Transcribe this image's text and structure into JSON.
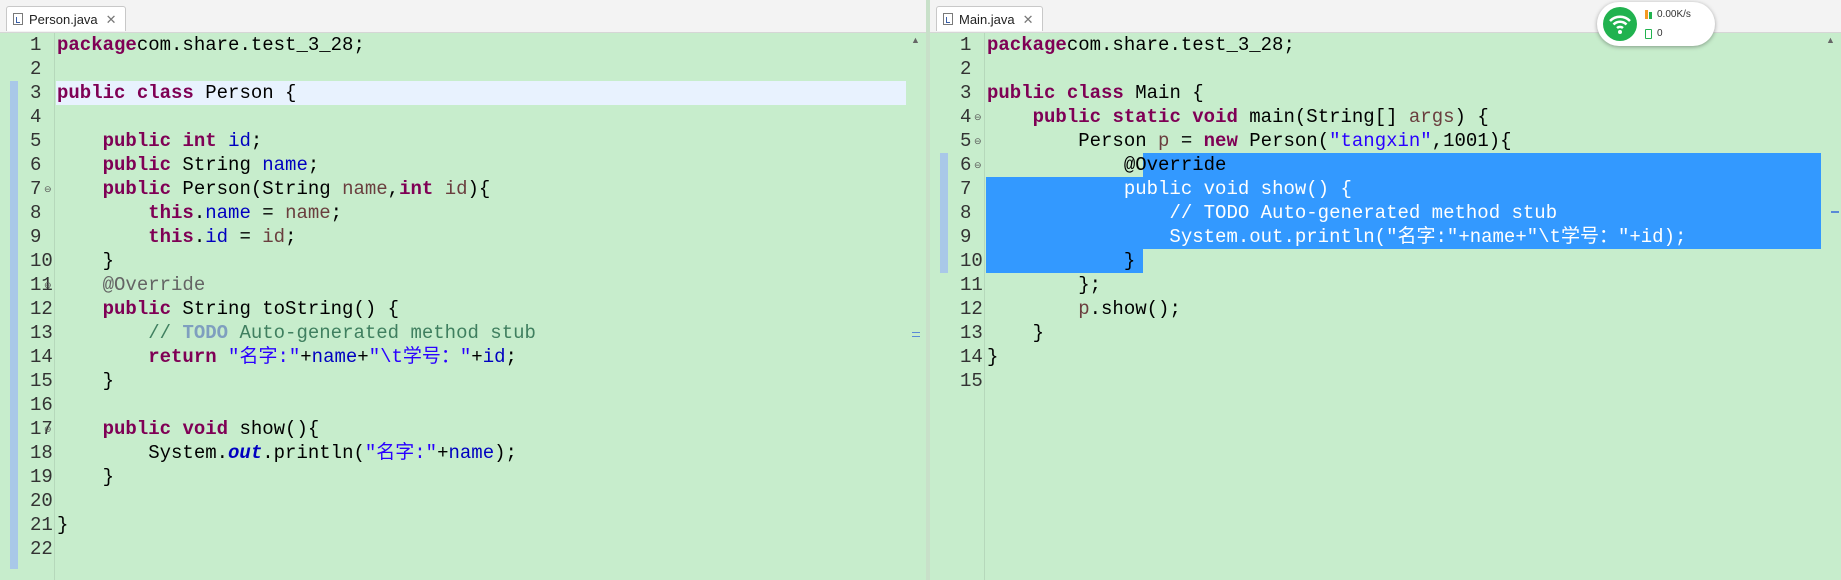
{
  "left_editor": {
    "tab_label": "Person.java",
    "lines": [
      [
        [
          "kw",
          "package"
        ],
        [
          "",
          "com.share.test_3_28;"
        ]
      ],
      [],
      [
        [
          "kw",
          "public"
        ],
        [
          "",
          " "
        ],
        [
          "kw",
          "class"
        ],
        [
          "",
          " Person {"
        ]
      ],
      [],
      [
        [
          "",
          "    "
        ],
        [
          "kw",
          "public"
        ],
        [
          "",
          " "
        ],
        [
          "kw",
          "int"
        ],
        [
          "",
          " "
        ],
        [
          "fld",
          "id"
        ],
        [
          "",
          ";"
        ]
      ],
      [
        [
          "",
          "    "
        ],
        [
          "kw",
          "public"
        ],
        [
          "",
          " String "
        ],
        [
          "fld",
          "name"
        ],
        [
          "",
          ";"
        ]
      ],
      [
        [
          "",
          "    "
        ],
        [
          "kw",
          "public"
        ],
        [
          "",
          " Person(String "
        ],
        [
          "par",
          "name"
        ],
        [
          "",
          ","
        ],
        [
          "kw",
          "int"
        ],
        [
          "",
          " "
        ],
        [
          "par",
          "id"
        ],
        [
          "",
          "){"
        ]
      ],
      [
        [
          "",
          "        "
        ],
        [
          "kw",
          "this"
        ],
        [
          "",
          "."
        ],
        [
          "fld",
          "name"
        ],
        [
          "",
          " = "
        ],
        [
          "par",
          "name"
        ],
        [
          "",
          ";"
        ]
      ],
      [
        [
          "",
          "        "
        ],
        [
          "kw",
          "this"
        ],
        [
          "",
          "."
        ],
        [
          "fld",
          "id"
        ],
        [
          "",
          " = "
        ],
        [
          "par",
          "id"
        ],
        [
          "",
          ";"
        ]
      ],
      [
        [
          "",
          "    }"
        ]
      ],
      [
        [
          "",
          "    "
        ],
        [
          "ann",
          "@Override"
        ]
      ],
      [
        [
          "",
          "    "
        ],
        [
          "kw",
          "public"
        ],
        [
          "",
          " String toString() {"
        ]
      ],
      [
        [
          "",
          "        "
        ],
        [
          "cmt",
          "// "
        ],
        [
          "todo",
          "TODO"
        ],
        [
          "cmt",
          " Auto-generated method stub"
        ]
      ],
      [
        [
          "",
          "        "
        ],
        [
          "kw",
          "return"
        ],
        [
          "",
          " "
        ],
        [
          "str",
          "\"名字:\""
        ],
        [
          "",
          "+"
        ],
        [
          "fld",
          "name"
        ],
        [
          "",
          "+"
        ],
        [
          "str",
          "\"\\t学号：\""
        ],
        [
          "",
          "+"
        ],
        [
          "fld",
          "id"
        ],
        [
          "",
          ";"
        ]
      ],
      [
        [
          "",
          "    }"
        ]
      ],
      [],
      [
        [
          "",
          "    "
        ],
        [
          "kw",
          "public"
        ],
        [
          "",
          " "
        ],
        [
          "kw",
          "void"
        ],
        [
          "",
          " show(){"
        ]
      ],
      [
        [
          "",
          "        System."
        ],
        [
          "stat",
          "out"
        ],
        [
          "",
          ".println("
        ],
        [
          "str",
          "\"名字:\""
        ],
        [
          "",
          "+"
        ],
        [
          "fld",
          "name"
        ],
        [
          "",
          ");"
        ]
      ],
      [
        [
          "",
          "    }"
        ]
      ],
      [],
      [
        [
          "",
          "}"
        ]
      ],
      []
    ]
  },
  "right_editor": {
    "tab_label": "Main.java",
    "lines": [
      [
        [
          "kw",
          "package"
        ],
        [
          "",
          "com.share.test_3_28;"
        ]
      ],
      [],
      [
        [
          "kw",
          "public"
        ],
        [
          "",
          " "
        ],
        [
          "kw",
          "class"
        ],
        [
          "",
          " Main {"
        ]
      ],
      [
        [
          "",
          "    "
        ],
        [
          "kw",
          "public"
        ],
        [
          "",
          " "
        ],
        [
          "kw",
          "static"
        ],
        [
          "",
          " "
        ],
        [
          "kw",
          "void"
        ],
        [
          "",
          " main(String[] "
        ],
        [
          "par",
          "args"
        ],
        [
          "",
          ") {"
        ]
      ],
      [
        [
          "",
          "        Person "
        ],
        [
          "par",
          "p"
        ],
        [
          "",
          " = "
        ],
        [
          "kw",
          "new"
        ],
        [
          "",
          " Person("
        ],
        [
          "str",
          "\"tangxin\""
        ],
        [
          "",
          ",1001){"
        ]
      ],
      [
        [
          "",
          "            @Override"
        ]
      ],
      [
        [
          "",
          "            "
        ],
        [
          "kw",
          "public"
        ],
        [
          "",
          " "
        ],
        [
          "kw",
          "void"
        ],
        [
          "",
          " show() {"
        ]
      ],
      [
        [
          "",
          "                "
        ],
        [
          "cmt",
          "// TODO Auto-generated method stub"
        ]
      ],
      [
        [
          "",
          "                System."
        ],
        [
          "stat",
          "out"
        ],
        [
          "",
          ".println("
        ],
        [
          "str",
          "\"名字:\""
        ],
        [
          "",
          "+"
        ],
        [
          "fld",
          "name"
        ],
        [
          "",
          "+"
        ],
        [
          "str",
          "\"\\t学号：\""
        ],
        [
          "",
          "+"
        ],
        [
          "fld",
          "id"
        ],
        [
          "",
          ");"
        ]
      ],
      [
        [
          "",
          "            }"
        ]
      ],
      [
        [
          "",
          "        };"
        ]
      ],
      [
        [
          "",
          "        "
        ],
        [
          "par",
          "p"
        ],
        [
          "",
          ".show();"
        ]
      ],
      [
        [
          "",
          "    }"
        ]
      ],
      [
        [
          "",
          "}"
        ]
      ],
      []
    ]
  },
  "net_widget": {
    "speed": "0.00K/s",
    "count": "0"
  }
}
